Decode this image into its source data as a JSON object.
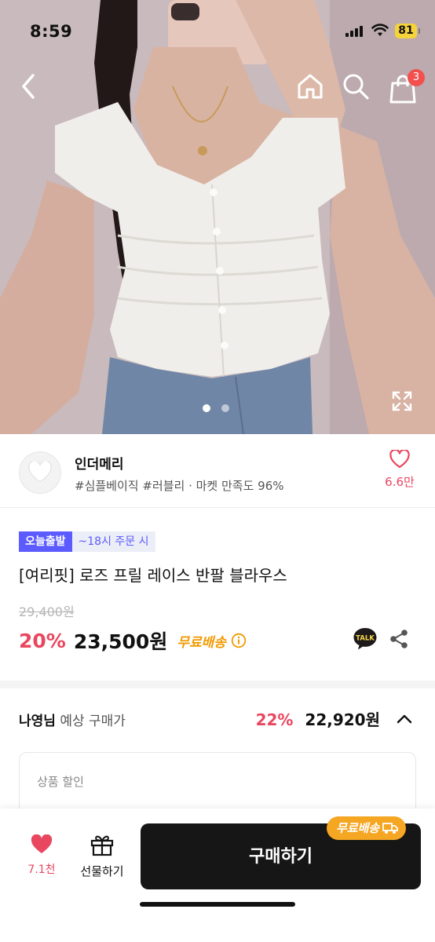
{
  "status_bar": {
    "time": "8:59",
    "battery": "81"
  },
  "header": {
    "cart_count": "3"
  },
  "gallery": {
    "current_index": 1,
    "total": 2
  },
  "shop": {
    "name": "인더메리",
    "tags": "#심플베이직 #러블리 · 마켓 만족도 96%",
    "like_count": "6.6만"
  },
  "product": {
    "badge_main": "오늘출발",
    "badge_sub": "~18시 주문 시",
    "title": "[여리핏] 로즈 프릴 레이스 반팔 블라우스",
    "original_price": "29,400원",
    "discount_rate": "20%",
    "price": "23,500원",
    "free_shipping": "무료배송",
    "talk_label": "TALK"
  },
  "expected_price": {
    "user_name": "나영님",
    "label": "예상 구매가",
    "rate": "22%",
    "price": "22,920원"
  },
  "discount_card": {
    "label": "상품 할인"
  },
  "bottom_bar": {
    "like_count": "7.1천",
    "gift_label": "선물하기",
    "buy_label": "구매하기",
    "shipping_tag": "무료배송"
  },
  "colors": {
    "accent_red": "#e9475f",
    "badge_blue": "#5b5bff",
    "free_ship_orange": "#f29a00",
    "buy_button": "#161616"
  }
}
